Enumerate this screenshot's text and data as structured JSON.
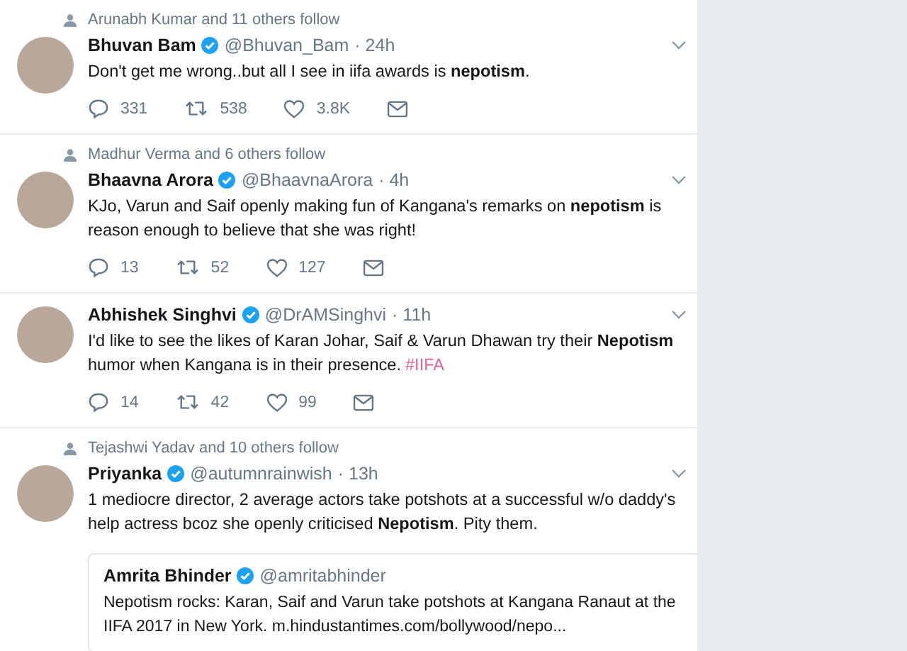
{
  "tweets": [
    {
      "social_context": "Arunabh Kumar and 11 others follow",
      "name": "Bhuvan Bam",
      "verified": true,
      "handle": "@Bhuvan_Bam",
      "time": "· 24h",
      "text": "Don't get me wrong..but all I see in iifa awards is **nepotism**.",
      "replies": "331",
      "retweets": "538",
      "likes": "3.8K"
    },
    {
      "social_context": "Madhur Verma and 6 others follow",
      "name": "Bhaavna Arora",
      "verified": true,
      "handle": "@BhaavnaArora",
      "time": "· 4h",
      "text": "KJo, Varun and Saif openly making fun of Kangana's remarks on **nepotism** is reason enough to believe that she was right!",
      "replies": "13",
      "retweets": "52",
      "likes": "127"
    },
    {
      "name": "Abhishek Singhvi",
      "verified": true,
      "handle": "@DrAMSinghvi",
      "time": "· 11h",
      "text": "I'd like to see the likes of Karan Johar, Saif & Varun Dhawan try their **Nepotism** humor when Kangana is in their presence.",
      "hashtag": "#IIFA",
      "replies": "14",
      "retweets": "42",
      "likes": "99"
    },
    {
      "social_context": "Tejashwi Yadav and 10 others follow",
      "name": "Priyanka",
      "verified": true,
      "handle": "@autumnrainwish",
      "time": "· 13h",
      "text": "1 mediocre director, 2 average actors take potshots at a successful w/o daddy's help actress bcoz she openly criticised **Nepotism**. Pity them.",
      "quote": {
        "name": "Amrita Bhinder",
        "verified": true,
        "handle": "@amritabhinder",
        "text": "Nepotism rocks: Karan, Saif and Varun take potshots at Kangana Ranaut at the IIFA 2017 in New York.  m.hindustantimes.com/bollywood/nepo..."
      }
    }
  ]
}
